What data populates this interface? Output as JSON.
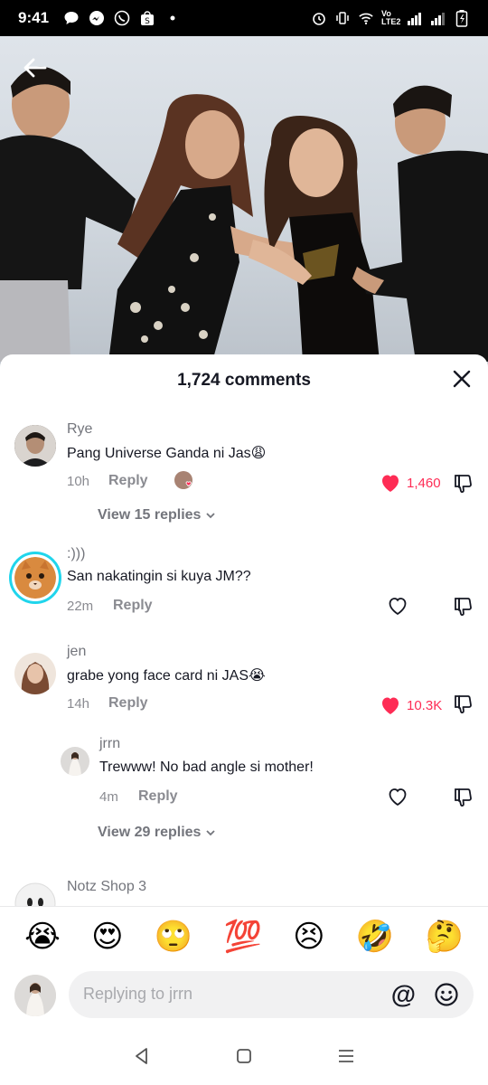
{
  "status_bar": {
    "time": "9:41",
    "icons": [
      "chat-bubble-icon",
      "messenger-icon",
      "viber-icon",
      "shopee-icon",
      "dot-icon",
      "alarm-icon",
      "vibrate-icon",
      "wifi-icon",
      "volte-icon",
      "signal-icon",
      "signal-icon",
      "battery-charging-icon"
    ],
    "volte_label": "Vo LTE2"
  },
  "header": {
    "back_icon": "arrow-left-icon"
  },
  "sheet": {
    "title": "1,724 comments",
    "close_icon": "close-icon"
  },
  "comments": [
    {
      "user": "Rye",
      "text": "Pang Universe Ganda ni Jas😩",
      "time": "10h",
      "reply_label": "Reply",
      "likes": "1,460",
      "liked": true,
      "view_replies": "View 15 replies"
    },
    {
      "user": ":)))",
      "text": "San nakatingin si kuya JM??",
      "time": "22m",
      "reply_label": "Reply",
      "likes": "",
      "liked": false
    },
    {
      "user": "jen",
      "text": "grabe yong face card ni JAS😭",
      "time": "14h",
      "reply_label": "Reply",
      "likes": "10.3K",
      "liked": true
    },
    {
      "user": "jrrn",
      "text": "Trewww! No bad angle si mother!",
      "time": "4m",
      "reply_label": "Reply",
      "likes": "",
      "liked": false,
      "view_replies": "View 29 replies"
    },
    {
      "user": "Notz Shop 3"
    }
  ],
  "emoji_bar": [
    "😭",
    "😍",
    "🙄",
    "💯",
    "😣",
    "🤣",
    "🤔"
  ],
  "input": {
    "placeholder": "Replying to jrrn",
    "at_label": "@"
  },
  "nav": {
    "back": "nav-back-icon",
    "home": "nav-home-icon",
    "recents": "nav-recents-icon"
  }
}
